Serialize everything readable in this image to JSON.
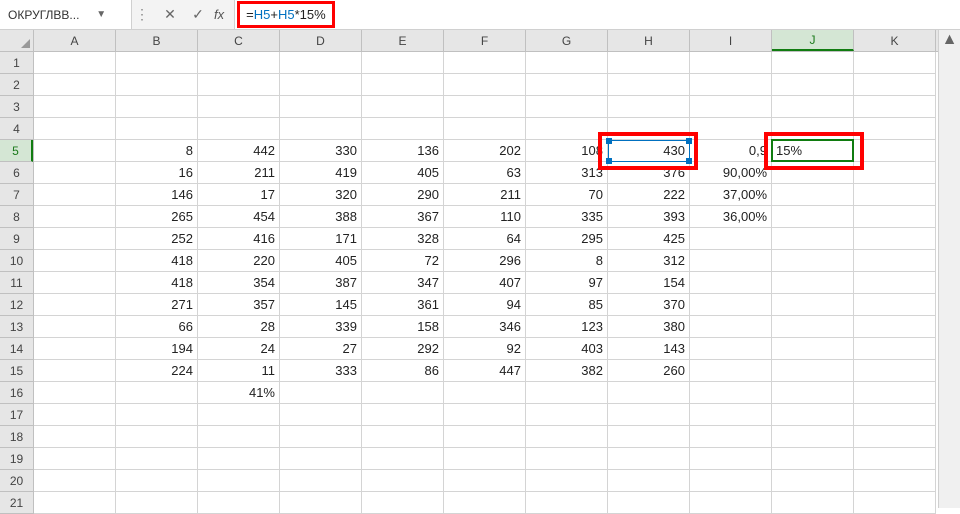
{
  "nameBox": "ОКРУГЛВВ...",
  "fxLabel": "fx",
  "formula": {
    "raw": "=H5+H5*15%",
    "eq": "=",
    "ref1": "H5",
    "plus": "+",
    "ref2": "H5",
    "mul": "*",
    "val": "15%"
  },
  "activeCellValue": "15%",
  "columns": [
    "A",
    "B",
    "C",
    "D",
    "E",
    "F",
    "G",
    "H",
    "I",
    "J",
    "K"
  ],
  "activeCol": "J",
  "rowCount": 21,
  "activeRow": "5",
  "grid": {
    "5": {
      "B": "8",
      "C": "442",
      "D": "330",
      "E": "136",
      "F": "202",
      "G": "108",
      "H": "430",
      "I": "0,9",
      "J": "15%"
    },
    "6": {
      "B": "16",
      "C": "211",
      "D": "419",
      "E": "405",
      "F": "63",
      "G": "313",
      "H": "376",
      "I": "90,00%"
    },
    "7": {
      "B": "146",
      "C": "17",
      "D": "320",
      "E": "290",
      "F": "211",
      "G": "70",
      "H": "222",
      "I": "37,00%"
    },
    "8": {
      "B": "265",
      "C": "454",
      "D": "388",
      "E": "367",
      "F": "110",
      "G": "335",
      "H": "393",
      "I": "36,00%"
    },
    "9": {
      "B": "252",
      "C": "416",
      "D": "171",
      "E": "328",
      "F": "64",
      "G": "295",
      "H": "425"
    },
    "10": {
      "B": "418",
      "C": "220",
      "D": "405",
      "E": "72",
      "F": "296",
      "G": "8",
      "H": "312"
    },
    "11": {
      "B": "418",
      "C": "354",
      "D": "387",
      "E": "347",
      "F": "407",
      "G": "97",
      "H": "154"
    },
    "12": {
      "B": "271",
      "C": "357",
      "D": "145",
      "E": "361",
      "F": "94",
      "G": "85",
      "H": "370"
    },
    "13": {
      "B": "66",
      "C": "28",
      "D": "339",
      "E": "158",
      "F": "346",
      "G": "123",
      "H": "380"
    },
    "14": {
      "B": "194",
      "C": "24",
      "D": "27",
      "E": "292",
      "F": "92",
      "G": "403",
      "H": "143"
    },
    "15": {
      "B": "224",
      "C": "11",
      "D": "333",
      "E": "86",
      "F": "447",
      "G": "382",
      "H": "260"
    },
    "16": {
      "C": "41%"
    }
  }
}
